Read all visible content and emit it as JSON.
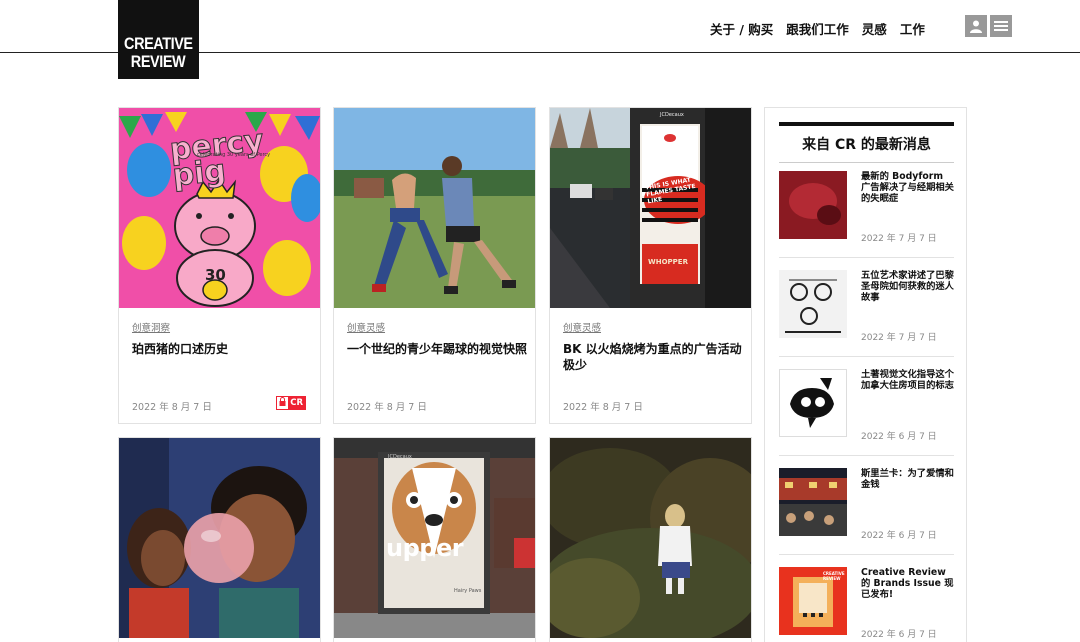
{
  "brand": {
    "line1": "CREATIVE",
    "line2": "REVIEW"
  },
  "nav": [
    "关于 / 购买",
    "跟我们工作",
    "灵感",
    "工作"
  ],
  "header_icons": [
    "user-icon",
    "menu-icon"
  ],
  "cards": [
    {
      "category": "创意洞察",
      "title": "珀西猪的口述历史",
      "date": "2022 年 8 月 7 日",
      "badge": {
        "lock": "🔒",
        "cr": "CR"
      },
      "image_text": {
        "brand": "percy pig",
        "sub": "celebrating 30 years of Percy",
        "number": "30"
      }
    },
    {
      "category": "创意灵感",
      "title": "一个世纪的青少年踢球的视觉快照",
      "date": "2022 年 8 月 7 日"
    },
    {
      "category": "创意灵感",
      "title": "BK 以火焰烧烤为重点的广告活动极少",
      "date": "2022 年 8 月 7 日",
      "image_text": {
        "top": "JCDecaux",
        "mid": "THIS IS WHAT FLAMES TASTE LIKE",
        "brand": "WHOPPER"
      }
    },
    {
      "image_text": {}
    },
    {
      "image_text": {
        "top": "JCDecaux",
        "word": "upper",
        "small": "Hairy Paws"
      }
    },
    {
      "image_text": {}
    }
  ],
  "sidebar": {
    "title": "来自 CR 的最新消息",
    "items": [
      {
        "text": "最新的 Bodyform 广告解决了与经期相关的失眠症",
        "date": "2022 年 7 月 7 日"
      },
      {
        "text": "五位艺术家讲述了巴黎圣母院如何获救的迷人故事",
        "date": "2022 年 7 月 7 日"
      },
      {
        "text": "土著视觉文化指导这个加拿大住房项目的标志",
        "date": "2022 年 6 月 7 日"
      },
      {
        "text": "斯里兰卡：为了爱情和金钱",
        "date": "2022 年 6 月 7 日"
      },
      {
        "text": "Creative Review 的 Brands Issue 现已发布!",
        "date": "2022 年 6 月 7 日",
        "image_text": "CREATIVE REVIEW"
      }
    ]
  },
  "colors": {
    "accent_red": "#e8222e",
    "text": "#111111",
    "muted": "#888888"
  }
}
